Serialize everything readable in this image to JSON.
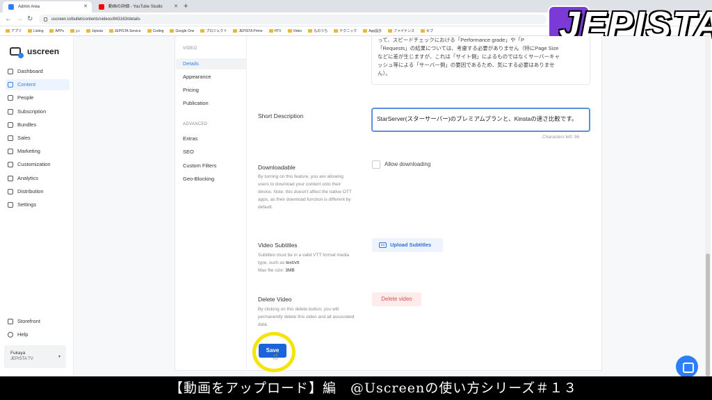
{
  "browser": {
    "tabs": [
      {
        "title": "Admin Area",
        "favicon_color": "#2d7ff9"
      },
      {
        "title": "動画の詳細 - YouTube Studio",
        "favicon_color": "#ff0000"
      }
    ],
    "url": "uscreen.io/bullet/contents/videos/843163/details",
    "bookmarks": [
      "アプリ",
      "Listing",
      "APPs",
      "y.c",
      "Jepista",
      "JEPISTA Service",
      "Coding",
      "Google One",
      "プロジェクト",
      "JEPISTA Prime",
      "HTV",
      "Video",
      "ものうち",
      "テクニック",
      "App設計",
      "ファイナンス",
      "セブ"
    ]
  },
  "watermark": "JEPISTA",
  "sidebar": {
    "logo": "uscreen",
    "items": [
      {
        "label": "Dashboard",
        "icon": "grid-icon"
      },
      {
        "label": "Content",
        "icon": "folder-icon",
        "active": true
      },
      {
        "label": "People",
        "icon": "people-icon"
      },
      {
        "label": "Subscription",
        "icon": "refresh-icon"
      },
      {
        "label": "Bundles",
        "icon": "box-icon"
      },
      {
        "label": "Sales",
        "icon": "dollar-icon"
      },
      {
        "label": "Marketing",
        "icon": "megaphone-icon"
      },
      {
        "label": "Customization",
        "icon": "edit-icon"
      },
      {
        "label": "Analytics",
        "icon": "chart-icon"
      },
      {
        "label": "Distribution",
        "icon": "share-icon"
      },
      {
        "label": "Settings",
        "icon": "gear-icon"
      }
    ],
    "bottom": [
      {
        "label": "Storefront",
        "icon": "store-icon"
      },
      {
        "label": "Help",
        "icon": "help-icon"
      }
    ],
    "user": {
      "name": "Fukaya",
      "org": "JEPISTA TV"
    }
  },
  "subnav": {
    "video_heading": "VIDEO",
    "video_items": [
      "Details",
      "Appearance",
      "Pricing",
      "Publication"
    ],
    "advanced_heading": "ADVANCED",
    "advanced_items": [
      "Extras",
      "SEO",
      "Custom Filters",
      "Geo-Blocking"
    ]
  },
  "form": {
    "description_tail": [
      "って、スピードチェックにおける「Performance grade」や「P",
      "「Requests」の結果については、考慮する必要がありません（特にPage Size",
      "などに差が生じますが、これは「サイト側」によるものではなくサーバーキャ",
      "ッシュ等による「サーバー側」の要因であるため、気にする必要はありませ",
      "ん）。"
    ],
    "short_description_label": "Short Description",
    "short_description_value": "StarServer(スターサーバー)のプレミアムプランと、Kinstaの速さ比較です。",
    "characters_left": "Characters left: 96",
    "downloadable_label": "Downloadable",
    "downloadable_desc": "By turning on this feature, you are allowing users to download your content onto their device. Note: this doesn't affect the native OTT apps, as their download function is different by default.",
    "allow_downloading_label": "Allow downloading",
    "subtitles_label": "Video Subtitles",
    "subtitles_desc_pre": "Subtitles must be in a valid VTT format media type, such as ",
    "subtitles_desc_format": "text/vtt",
    "subtitles_desc_size_pre": "Max file size: ",
    "subtitles_desc_size": "3MB",
    "upload_subtitles": "Upload Subtitles",
    "delete_label": "Delete Video",
    "delete_desc": "By clicking on this delete button, you will permanently delete this video and all associated data.",
    "delete_button": "Delete video",
    "save_button": "Save"
  },
  "caption": "【動画をアップロード】編　@Uscreenの使い方シリーズ＃１３"
}
